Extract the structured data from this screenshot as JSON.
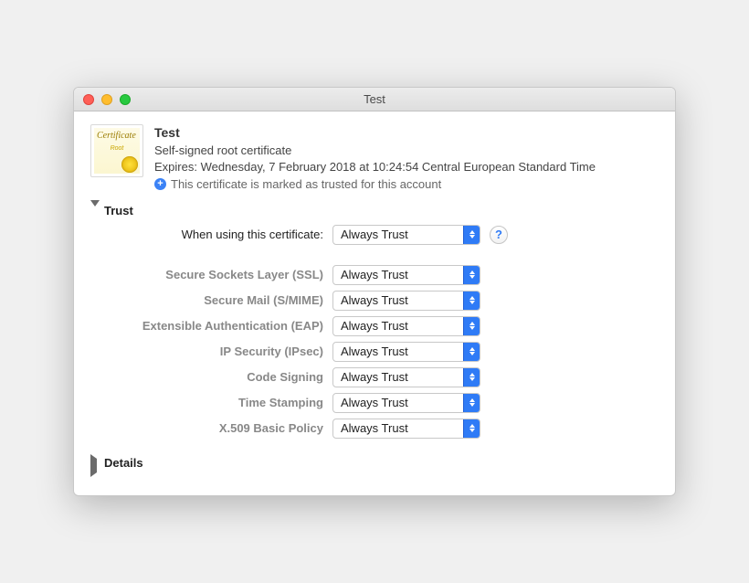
{
  "window": {
    "title": "Test"
  },
  "certificate": {
    "name": "Test",
    "subtitle": "Self-signed root certificate",
    "expires": "Expires: Wednesday, 7 February 2018 at 10:24:54 Central European Standard Time",
    "trusted_text": "This certificate is marked as trusted for this account",
    "icon_label": "Certificate",
    "icon_sub": "Root"
  },
  "sections": {
    "trust_title": "Trust",
    "details_title": "Details"
  },
  "trust": {
    "when_using_label": "When using this certificate:",
    "when_using_value": "Always Trust",
    "help": "?",
    "rows": [
      {
        "label": "Secure Sockets Layer (SSL)",
        "value": "Always Trust"
      },
      {
        "label": "Secure Mail (S/MIME)",
        "value": "Always Trust"
      },
      {
        "label": "Extensible Authentication (EAP)",
        "value": "Always Trust"
      },
      {
        "label": "IP Security (IPsec)",
        "value": "Always Trust"
      },
      {
        "label": "Code Signing",
        "value": "Always Trust"
      },
      {
        "label": "Time Stamping",
        "value": "Always Trust"
      },
      {
        "label": "X.509 Basic Policy",
        "value": "Always Trust"
      }
    ]
  }
}
